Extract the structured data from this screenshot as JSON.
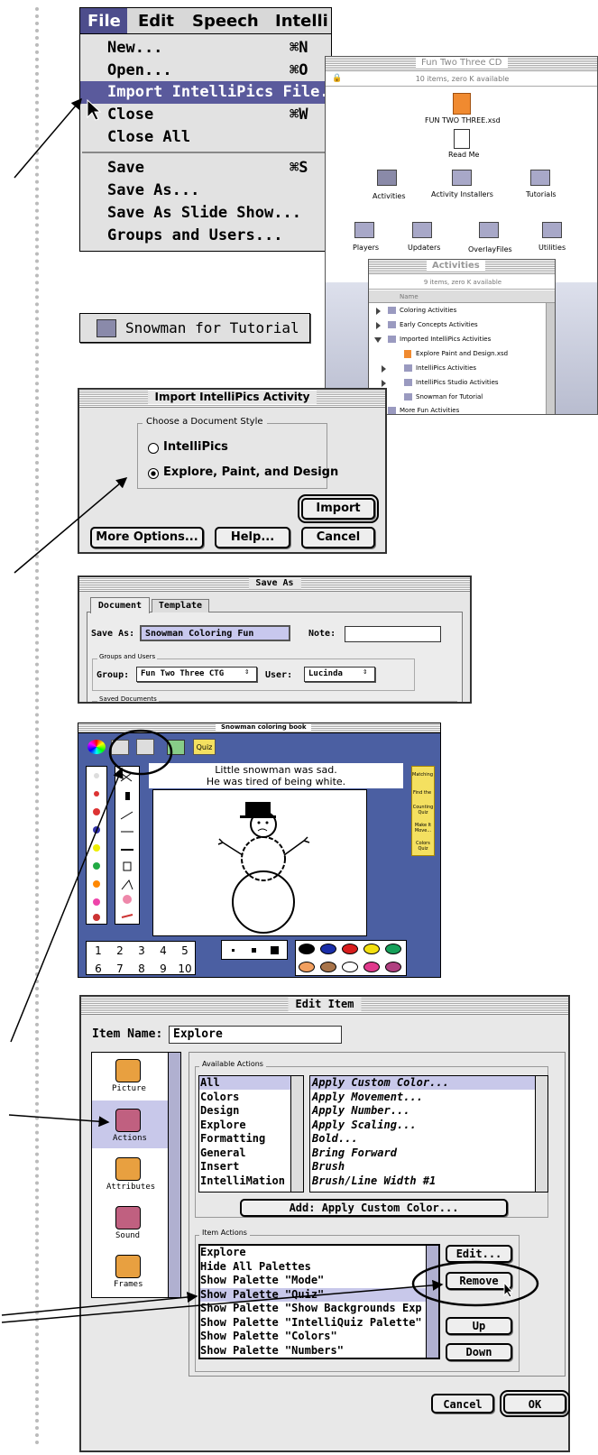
{
  "file_menu": {
    "bar": [
      "File",
      "Edit",
      "Speech",
      "Intelli"
    ],
    "items": [
      {
        "label": "New...",
        "key": "⌘N"
      },
      {
        "label": "Open...",
        "key": "⌘O"
      },
      {
        "label": "Import IntelliPics File...",
        "key": ""
      },
      {
        "label": "Close",
        "key": "⌘W"
      },
      {
        "label": "Close All",
        "key": ""
      },
      {
        "label": "Save",
        "key": "⌘S"
      },
      {
        "label": "Save As...",
        "key": ""
      },
      {
        "label": "Save As Slide Show...",
        "key": ""
      },
      {
        "label": "Groups and Users...",
        "key": ""
      }
    ]
  },
  "cd_window": {
    "title": "Fun Two Three CD",
    "status": "10 items, zero K available",
    "items": [
      "FUN TWO THREE.xsd",
      "Read Me",
      "Activities",
      "Activity Installers",
      "Tutorials",
      "Players",
      "Updaters",
      "OverlayFiles",
      "Utilities"
    ]
  },
  "activities_window": {
    "title": "Activities",
    "status": "9 items, zero K available",
    "col": "Name",
    "rows": [
      "Coloring Activities",
      "Early Concepts Activities",
      "Imported IntelliPics Activities",
      "Explore Paint and Design.xsd",
      "IntelliPics Activities",
      "IntelliPics Studio Activities",
      "Snowman for Tutorial",
      "More Fun Activities"
    ]
  },
  "folder_label": "Snowman for Tutorial",
  "import_dialog": {
    "title": "Import IntelliPics Activity",
    "group": "Choose a Document Style",
    "options": [
      "IntelliPics",
      "Explore, Paint, and Design"
    ],
    "import": "Import",
    "more": "More Options...",
    "help": "Help...",
    "cancel": "Cancel"
  },
  "save_as": {
    "title": "Save As",
    "tabs": [
      "Document",
      "Template"
    ],
    "save_as_label": "Save As:",
    "save_as_value": "Snowman Coloring Fun",
    "note_label": "Note:",
    "note_value": "",
    "groups_users": "Groups and Users",
    "group_label": "Group:",
    "group_value": "Fun Two Three CTG",
    "user_label": "User:",
    "user_value": "Lucinda",
    "saved_docs": "Saved Documents"
  },
  "snowman_window": {
    "title": "Snowman coloring book",
    "quiz": "Quiz",
    "caption": [
      "Little snowman was sad.",
      "He was tired of being white."
    ],
    "side": [
      "Matching",
      "Find the",
      "Counting Quiz",
      "Make It Move...",
      "Colors Quiz"
    ],
    "numbers": [
      "1",
      "2",
      "3",
      "4",
      "5",
      "6",
      "7",
      "8",
      "9",
      "10"
    ],
    "colors": [
      "#000000",
      "#1a2ea8",
      "#d81e1e",
      "#f4e010",
      "#17a05a",
      "#f2a060",
      "#a8744a",
      "#ffffff",
      "#e03a8c",
      "#b04080"
    ]
  },
  "edit_item": {
    "title": "Edit Item",
    "name_label": "Item Name:",
    "name_value": "Explore",
    "categories": [
      "Picture",
      "Actions",
      "Attributes",
      "Sound",
      "Frames"
    ],
    "available_group": "Available Actions",
    "action_types": [
      "All",
      "Colors",
      "Design",
      "Explore",
      "Formatting",
      "General",
      "Insert",
      "IntelliMation"
    ],
    "actions": [
      "Apply Custom Color...",
      "Apply Movement...",
      "Apply Number...",
      "Apply Scaling...",
      "Bold...",
      "Bring Forward",
      "Brush",
      "Brush/Line Width #1"
    ],
    "add_button": "Add:  Apply Custom Color...",
    "item_group": "Item Actions",
    "item_actions": [
      "Explore",
      "Hide All Palettes",
      "Show Palette \"Mode\"",
      "Show Palette \"Quiz\"",
      "Show Palette \"Show Backgrounds Exp...",
      "Show Palette \"IntelliQuiz Palette\"",
      "Show Palette \"Colors\"",
      "Show Palette \"Numbers\""
    ],
    "edit": "Edit...",
    "remove": "Remove",
    "up": "Up",
    "down": "Down",
    "cancel": "Cancel",
    "ok": "OK"
  }
}
